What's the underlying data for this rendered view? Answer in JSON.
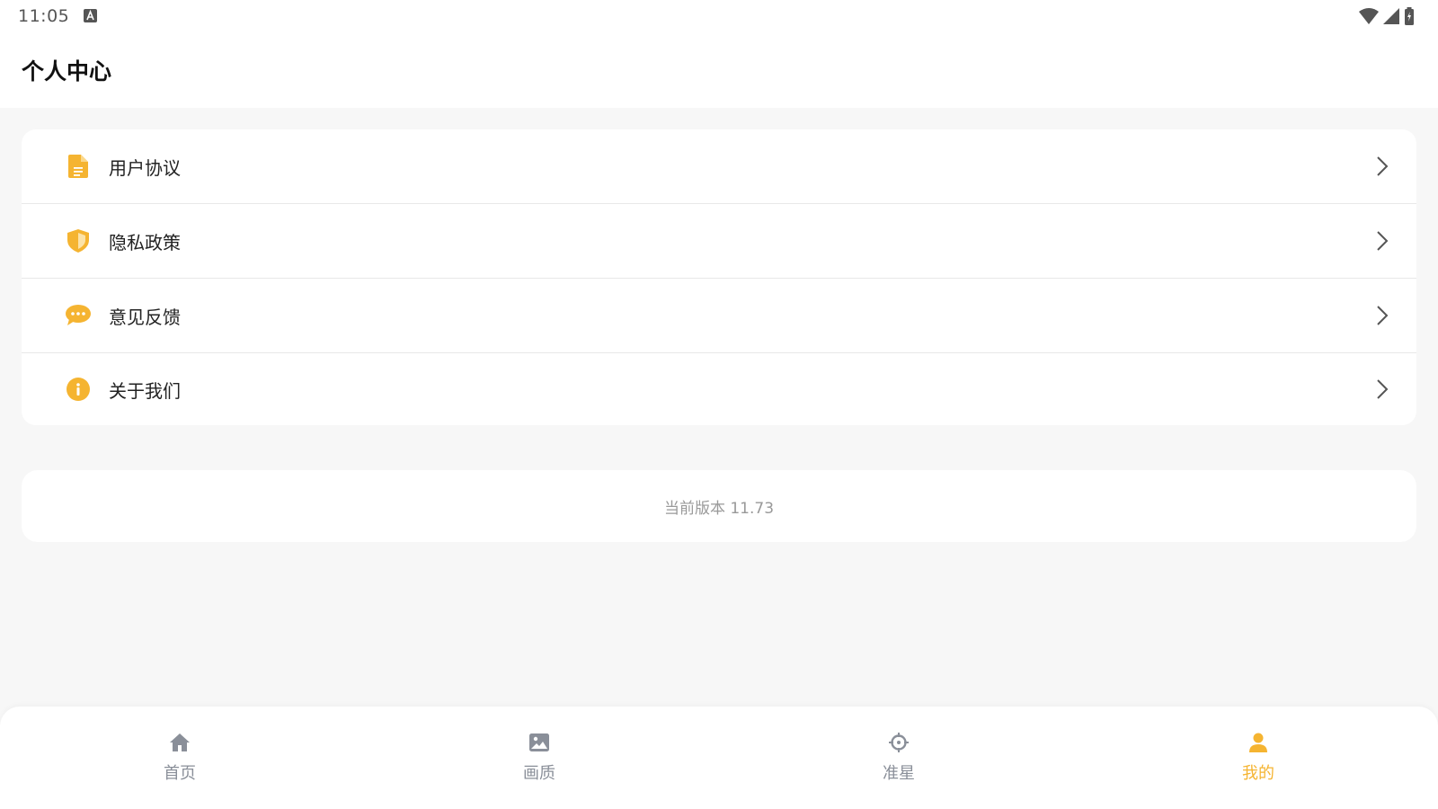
{
  "status_bar": {
    "time": "11:05",
    "icons": [
      "keyboard-a-icon",
      "wifi-icon",
      "signal-icon",
      "battery-charging-icon"
    ]
  },
  "header": {
    "title": "个人中心"
  },
  "menu": {
    "items": [
      {
        "label": "用户协议",
        "icon": "document-icon"
      },
      {
        "label": "隐私政策",
        "icon": "shield-icon"
      },
      {
        "label": "意见反馈",
        "icon": "chat-bubble-icon"
      },
      {
        "label": "关于我们",
        "icon": "info-icon"
      }
    ]
  },
  "version": {
    "text": "当前版本 11.73"
  },
  "bottom_nav": {
    "items": [
      {
        "label": "首页",
        "icon": "home-icon"
      },
      {
        "label": "画质",
        "icon": "image-icon"
      },
      {
        "label": "准星",
        "icon": "crosshair-icon"
      },
      {
        "label": "我的",
        "icon": "user-icon",
        "active": true
      }
    ]
  },
  "colors": {
    "accent": "#f5b431",
    "nav_inactive": "#8a8f99",
    "background": "#f7f7f7",
    "card": "#ffffff"
  }
}
